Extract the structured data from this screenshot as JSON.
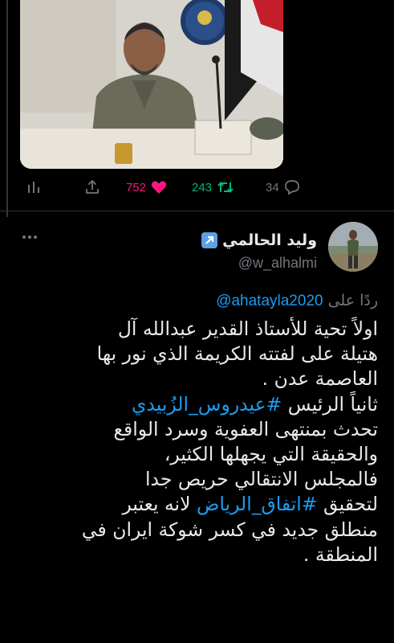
{
  "media": {
    "scene": "photo-man-at-desk-with-flag-and-emblem"
  },
  "actions": {
    "stats_icon": "bar-chart-icon",
    "share_icon": "share-icon",
    "likes": "752",
    "retweets": "243",
    "replies": "34"
  },
  "reply_tweet": {
    "display_name": "وليد الحالمي",
    "display_name_emoji": "up-right-arrow-emoji",
    "username": "@w_alhalmi",
    "reply_to_prefix": "ردًا على",
    "reply_to_handle": "@ahatayla2020",
    "lines": {
      "l1": "اولاً تحية للأستاذ القدير عبدالله آل",
      "l2": "هتيلة على لفتته الكريمة الذي نور بها",
      "l3": "العاصمة عدن .",
      "l4_text": "ثانياً الرئيس ",
      "l4_hashtag": "#عيدروس_الزُبيدي",
      "l5": "تحدث بمنتهى العفوية وسرد الواقع",
      "l6": "والحقيقة التي يجهلها الكثير،",
      "l7": "فالمجلس الانتقالي حريص جدا",
      "l8_text_a": "لتحقيق ",
      "l8_hashtag": "#اتفاق_الرياض",
      "l8_text_b": " لانه يعتبر",
      "l9": "منطلق جديد في كسر شوكة ايران في",
      "l10": "المنطقة ."
    }
  },
  "colors": {
    "background": "#000000",
    "text": "#e7e9ea",
    "muted": "#71767b",
    "link": "#1d9bf0",
    "like": "#f91880",
    "retweet": "#00ba7c"
  }
}
